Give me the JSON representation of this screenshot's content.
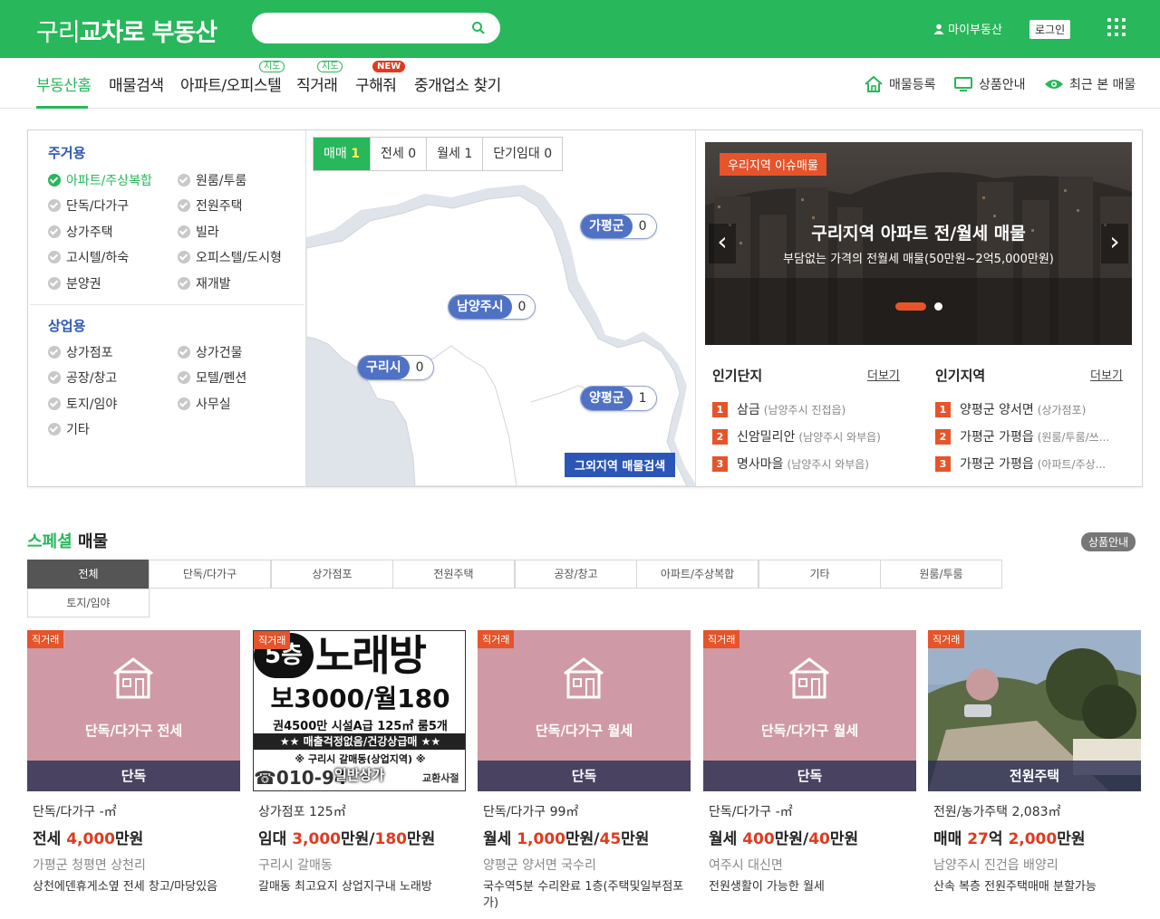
{
  "header": {
    "logo_light": "구리",
    "logo_bold": "교차로 부동산",
    "search_placeholder": "",
    "my_page": "마이부동산",
    "login": "로그인"
  },
  "nav": {
    "items": [
      {
        "label": "부동산홈",
        "badge": ""
      },
      {
        "label": "매물검색",
        "badge": ""
      },
      {
        "label": "아파트/오피스텔",
        "badge": "지도"
      },
      {
        "label": "직거래",
        "badge": "지도"
      },
      {
        "label": "구해줘",
        "badge": "NEW"
      },
      {
        "label": "중개업소 찾기",
        "badge": ""
      }
    ],
    "right": [
      "매물등록",
      "상품안내",
      "최근 본 매물"
    ]
  },
  "filters": {
    "residential_title": "주거용",
    "residential": [
      "아파트/주상복합",
      "원룸/투룸",
      "단독/다가구",
      "전원주택",
      "상가주택",
      "빌라",
      "고시텔/하숙",
      "오피스텔/도시형",
      "분양권",
      "재개발"
    ],
    "commercial_title": "상업용",
    "commercial": [
      "상가점포",
      "상가건물",
      "공장/창고",
      "모텔/펜션",
      "토지/임야",
      "사무실",
      "기타"
    ]
  },
  "map": {
    "tabs": [
      {
        "label": "매매",
        "count": "1"
      },
      {
        "label": "전세",
        "count": "0"
      },
      {
        "label": "월세",
        "count": "1"
      },
      {
        "label": "단기임대",
        "count": "0"
      }
    ],
    "regions": [
      {
        "name": "가평군",
        "count": "0"
      },
      {
        "name": "남양주시",
        "count": "0"
      },
      {
        "name": "구리시",
        "count": "0"
      },
      {
        "name": "양평군",
        "count": "1"
      }
    ],
    "other_search": "그외지역 매물검색"
  },
  "banner": {
    "tag": "우리지역 이슈매물",
    "title": "구리지역 아파트 전/월세 매물",
    "subtitle": "부담없는 가격의 전월세 매물(50만원~2억5,000만원)"
  },
  "popular_complex": {
    "title": "인기단지",
    "more": "더보기",
    "items": [
      {
        "rank": "1",
        "name": "삼금",
        "sub": "(남양주시 진접읍)"
      },
      {
        "rank": "2",
        "name": "신암밀리안",
        "sub": "(남양주시 와부읍)"
      },
      {
        "rank": "3",
        "name": "명사마을",
        "sub": "(남양주시 와부읍)"
      }
    ]
  },
  "popular_region": {
    "title": "인기지역",
    "more": "더보기",
    "items": [
      {
        "rank": "1",
        "name": "양평군 양서면",
        "sub": "(상가점포)"
      },
      {
        "rank": "2",
        "name": "가평군 가평읍",
        "sub": "(원룸/투룸/쓰..."
      },
      {
        "rank": "3",
        "name": "가평군 가평읍",
        "sub": "(아파트/주상..."
      }
    ]
  },
  "special": {
    "title_accent": "스페셜",
    "title_rest": " 매물",
    "product_btn": "상품안내",
    "tabs": [
      "전체",
      "단독/다가구",
      "상가점포",
      "전원주택",
      "공장/창고",
      "아파트/주상복합",
      "기타",
      "원룸/투룸",
      "토지/임야"
    ]
  },
  "cards": [
    {
      "tag": "직거래",
      "image_type": "단독/다가구 전세",
      "bottom": "단독",
      "area": "단독/다가구 -㎡",
      "price_pre": "전세 ",
      "price_n1": "4,000",
      "price_mid": "만원",
      "price_n2": "",
      "price_post": "",
      "loc": "가평군 청평면 상천리",
      "desc": "상천에덴휴게소옆 전세 창고/마당있음"
    },
    {
      "tag": "직거래",
      "image_type": "",
      "bottom": "일반상가",
      "area": "상가점포 125㎡",
      "price_pre": "임대 ",
      "price_n1": "3,000",
      "price_mid": "만원/",
      "price_n2": "180",
      "price_post": "만원",
      "loc": "구리시 갈매동",
      "desc": "갈매동 최고요지 상업지구내 노래방",
      "ad": {
        "l1a": "5층",
        "l1b": "노래방",
        "l2": "보3000/월180",
        "l3": "권4500만 시설A급 125㎡ 룸5개",
        "l4": "★★ 매출걱정없음/건강상급매 ★★",
        "l5": "※ 구리시 갈매동(상업지역) ※",
        "l6": "☎010-94",
        "l7": "교환사절"
      }
    },
    {
      "tag": "직거래",
      "image_type": "단독/다가구 월세",
      "bottom": "단독",
      "area": "단독/다가구 99㎡",
      "price_pre": "월세 ",
      "price_n1": "1,000",
      "price_mid": "만원/",
      "price_n2": "45",
      "price_post": "만원",
      "loc": "양평군 양서면 국수리",
      "desc": "국수역5분 수리완료 1층(주택및일부점포가)"
    },
    {
      "tag": "직거래",
      "image_type": "단독/다가구 월세",
      "bottom": "단독",
      "area": "단독/다가구 -㎡",
      "price_pre": "월세 ",
      "price_n1": "400",
      "price_mid": "만원/",
      "price_n2": "40",
      "price_post": "만원",
      "loc": "여주시 대신면",
      "desc": "전원생활이 가능한 월세"
    },
    {
      "tag": "직거래",
      "image_type": "",
      "bottom": "전원주택",
      "area": "전원/농가주택 2,083㎡",
      "price_pre": "매매 ",
      "price_n1": "27",
      "price_mid": "억 ",
      "price_n2": "2,000",
      "price_post": "만원",
      "loc": "남양주시 진건읍 배양리",
      "desc": "산속 복층 전원주택매매 분할가능"
    }
  ],
  "colors": {
    "brand": "#28b75a",
    "accent": "#e5542a",
    "link_blue": "#2b56b5",
    "card_pink": "#cf9aa5"
  }
}
